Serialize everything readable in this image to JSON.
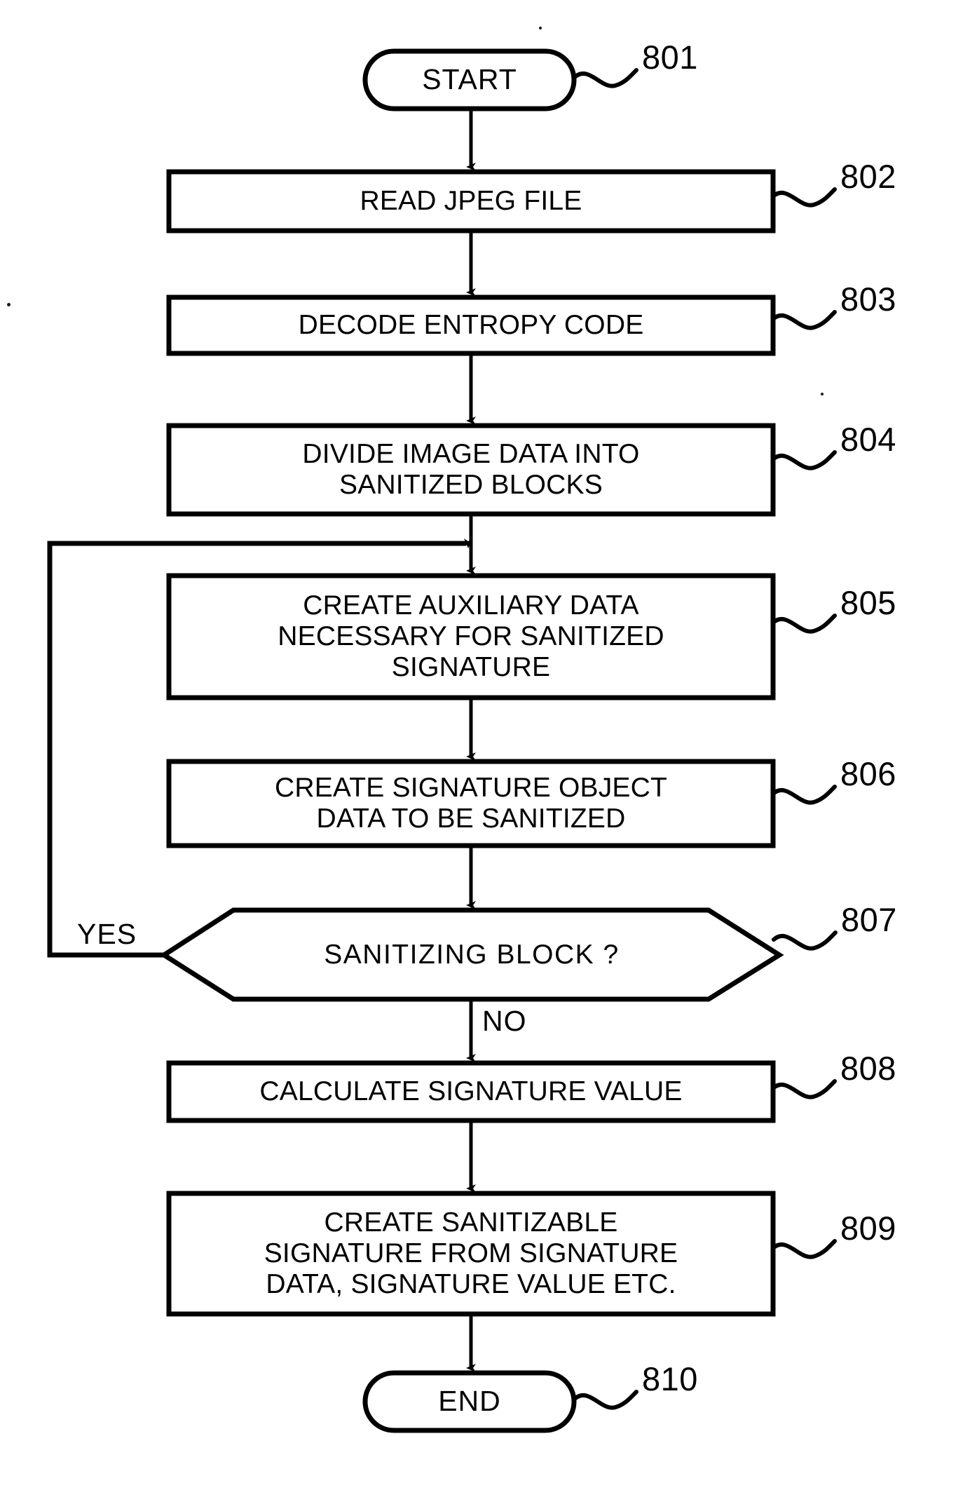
{
  "figure": {
    "type": "flowchart",
    "orientation": "top-to-bottom",
    "background_color": "#ffffff",
    "stroke_color": "#000000"
  },
  "nodes": {
    "start": {
      "id": "801",
      "label": "START",
      "shape": "rounded-terminal"
    },
    "read_jpeg": {
      "id": "802",
      "label": "READ JPEG FILE",
      "shape": "process-rectangle"
    },
    "decode_entropy": {
      "id": "803",
      "label": "DECODE ENTROPY CODE",
      "shape": "process-rectangle"
    },
    "divide_image": {
      "id": "804",
      "label": "DIVIDE IMAGE DATA INTO\nSANITIZED BLOCKS",
      "shape": "process-rectangle"
    },
    "create_auxiliary": {
      "id": "805",
      "label": "CREATE AUXILIARY DATA\nNECESSARY FOR SANITIZED\nSIGNATURE",
      "shape": "process-rectangle"
    },
    "create_signature_object": {
      "id": "806",
      "label": "CREATE SIGNATURE OBJECT\nDATA TO BE SANITIZED",
      "shape": "process-rectangle"
    },
    "sanitizing_block": {
      "id": "807",
      "label": "SANITIZING BLOCK ?",
      "shape": "decision-hexagon"
    },
    "calculate_signature": {
      "id": "808",
      "label": "CALCULATE SIGNATURE VALUE",
      "shape": "process-rectangle"
    },
    "create_sanitizable": {
      "id": "809",
      "label": "CREATE SANITIZABLE\nSIGNATURE FROM SIGNATURE\nDATA, SIGNATURE VALUE ETC.",
      "shape": "process-rectangle"
    },
    "end": {
      "id": "810",
      "label": "END",
      "shape": "rounded-terminal"
    }
  },
  "edges": {
    "yes_branch_label": "YES",
    "no_branch_label": "NO"
  }
}
